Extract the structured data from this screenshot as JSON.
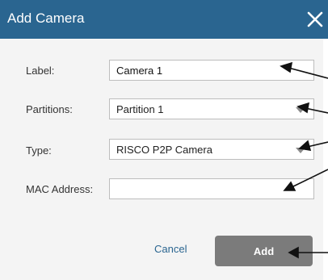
{
  "dialog": {
    "title": "Add Camera"
  },
  "form": {
    "label": {
      "caption": "Label:",
      "value": "Camera 1"
    },
    "partitions": {
      "caption": "Partitions:",
      "selected": "Partition 1"
    },
    "type": {
      "caption": "Type:",
      "selected": "RISCO P2P Camera"
    },
    "mac": {
      "caption": "MAC Address:",
      "value": ""
    }
  },
  "buttons": {
    "cancel": "Cancel",
    "add": "Add"
  },
  "colors": {
    "titlebar": "#2a6590",
    "content_bg": "#f4f4f4",
    "add_button": "#7b7b7b",
    "cancel_link": "#2a6590"
  },
  "icons": {
    "close": "close-icon",
    "dropdown": "triangle-down-icon"
  }
}
